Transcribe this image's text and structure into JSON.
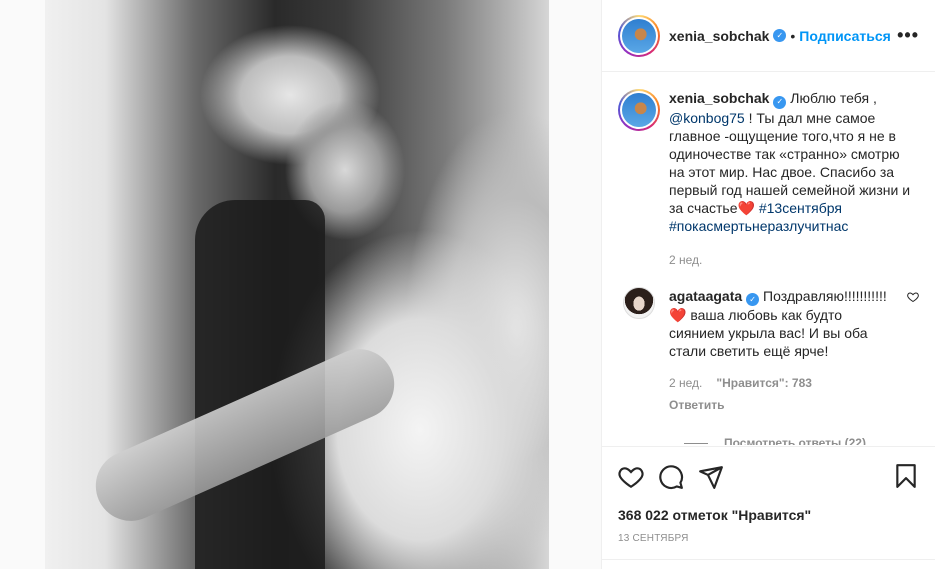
{
  "post": {
    "image_alt": "wedding photo"
  },
  "header": {
    "username": "xenia_sobchak",
    "separator": "•",
    "follow_label": "Подписаться",
    "more_label": "•••"
  },
  "caption": {
    "username": "xenia_sobchak",
    "text_1": "Люблю тебя ,",
    "mention": "@konbog75",
    "text_2": "! Ты дал мне самое главное -ощущение того,что я не в одиночестве так «странно» смотрю на этот мир. Нас двое. Спасибо за первый год нашей семейной жизни и за счастье",
    "heart": "❤️",
    "hashtag_1": "#13сентября",
    "hashtag_2": "#покасмертьнеразлучитнас",
    "time": "2 нед."
  },
  "comment": {
    "username": "agataagata",
    "text_1": "Поздравляю!!!!!!!!!!!",
    "heart": "❤️",
    "text_2": "ваша любовь как будто сиянием укрыла вас! И вы оба стали светить ещё ярче!",
    "time": "2 нед.",
    "likes": "\"Нравится\": 783",
    "reply_label": "Ответить",
    "view_replies": "Посмотреть ответы (22)"
  },
  "actions": {
    "likes_count": "368 022 отметок \"Нравится\"",
    "date": "13 СЕНТЯБРЯ"
  },
  "icons": {
    "verified": "verified-badge-icon",
    "heart": "heart-icon",
    "comment": "comment-icon",
    "share": "share-icon",
    "bookmark": "bookmark-icon"
  }
}
